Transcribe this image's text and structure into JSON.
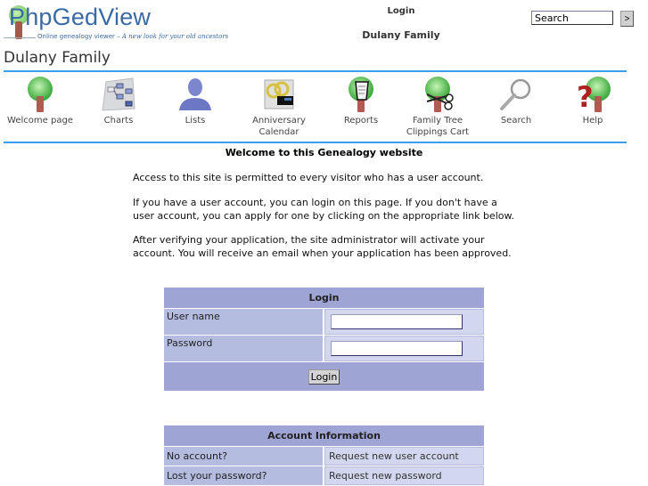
{
  "header": {
    "logo_title": "PhpGedView",
    "logo_tagline": "Online genealogy viewer –",
    "logo_tagline_italic": "A new look for your old ancestors",
    "page_label": "Login",
    "family_name": "Dulany Family",
    "search_value": "Search",
    "search_go_label": ">"
  },
  "site_title": "Dulany Family",
  "menu": [
    {
      "label": "Welcome page",
      "icon": "tree-icon"
    },
    {
      "label": "Charts",
      "icon": "charts-icon"
    },
    {
      "label": "Lists",
      "icon": "person-icon"
    },
    {
      "label": "Anniversary Calendar",
      "icon": "calendar-icon"
    },
    {
      "label": "Reports",
      "icon": "reports-icon"
    },
    {
      "label": "Family Tree Clippings Cart",
      "icon": "scissors-icon"
    },
    {
      "label": "Search",
      "icon": "magnifier-icon"
    },
    {
      "label": "Help",
      "icon": "help-icon"
    }
  ],
  "welcome": {
    "title": "Welcome to this Genealogy website",
    "paragraphs": [
      "Access to this site is permitted to every visitor who has a user account.",
      "If you have a user account, you can login on this page. If you don't have a user account, you can apply for one by clicking on the appropriate link below.",
      "After verifying your application, the site administrator will activate your account. You will receive an email when your application has been approved."
    ]
  },
  "login_form": {
    "title": "Login",
    "username_label": "User name",
    "username_value": "",
    "password_label": "Password",
    "password_value": "",
    "submit_label": "Login"
  },
  "account_info": {
    "title": "Account Information",
    "rows": [
      {
        "label": "No account?",
        "link": "Request new user account"
      },
      {
        "label": "Lost your password?",
        "link": "Request new password"
      }
    ]
  },
  "colors": {
    "accent_line": "#3aa0ee",
    "table_header": "#9ea4d4",
    "table_label": "#b4bde0",
    "table_value": "#d2d7ef"
  }
}
